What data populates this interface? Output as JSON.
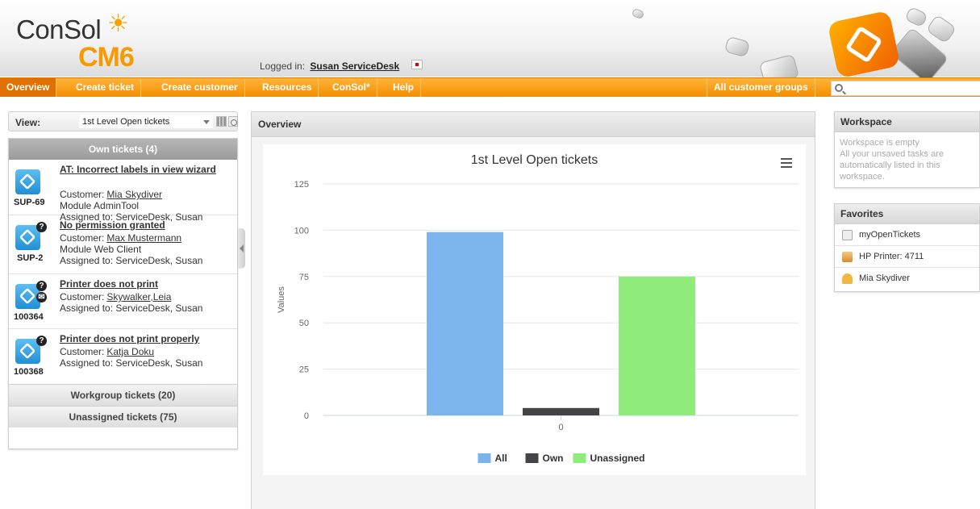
{
  "header": {
    "logo_text": "ConSol",
    "logo_product": "CM6",
    "logged_in_label": "Logged in:",
    "user_name": "Susan ServiceDesk"
  },
  "nav": {
    "items": [
      {
        "label": "Overview",
        "active": true
      },
      {
        "label": "Create ticket"
      },
      {
        "label": "Create customer"
      },
      {
        "label": "Resources"
      },
      {
        "label": "ConSol*"
      },
      {
        "label": "Help"
      }
    ],
    "customer_groups_label": "All customer groups",
    "search_placeholder": ""
  },
  "view": {
    "label": "View:",
    "selected": "1st Level Open tickets"
  },
  "tickets": {
    "own_header": "Own tickets (4)",
    "items": [
      {
        "id": "SUP-69",
        "title": "AT: Incorrect labels in view wizard",
        "customer_label": "Customer:",
        "customer": "Mia Skydiver",
        "module": "Module  AdminTool",
        "assigned": "Assigned to: ServiceDesk, Susan"
      },
      {
        "id": "SUP-2",
        "title": "No permission granted",
        "customer_label": "Customer:",
        "customer": "Max Mustermann",
        "module": "Module  Web Client",
        "assigned": "Assigned to: ServiceDesk, Susan"
      },
      {
        "id": "100364",
        "title": "Printer does not print",
        "customer_label": "Customer:",
        "customer": "Skywalker,Leia",
        "assigned": "Assigned to: ServiceDesk, Susan"
      },
      {
        "id": "100368",
        "title": "Printer does not print properly",
        "customer_label": "Customer:",
        "customer": "Katja Doku",
        "assigned": "Assigned to: ServiceDesk, Susan"
      }
    ],
    "workgroup_label": "Workgroup tickets (20)",
    "unassigned_label": "Unassigned tickets (75)"
  },
  "center": {
    "title": "Overview"
  },
  "chart_data": {
    "type": "bar",
    "title": "1st Level Open tickets",
    "ylabel": "Values",
    "xlabel": "",
    "categories": [
      "0"
    ],
    "ylim": [
      0,
      125
    ],
    "yticks": [
      0,
      25,
      50,
      75,
      100,
      125
    ],
    "grid": true,
    "legend_position": "bottom",
    "series": [
      {
        "name": "All",
        "values": [
          99
        ],
        "color": "#7cb5ec"
      },
      {
        "name": "Own",
        "values": [
          4
        ],
        "color": "#434348"
      },
      {
        "name": "Unassigned",
        "values": [
          75
        ],
        "color": "#90ed7d"
      }
    ]
  },
  "workspace": {
    "title": "Workspace",
    "line1": "Workspace is empty",
    "line2": "All your unsaved tasks are automatically listed in this workspace."
  },
  "favorites": {
    "title": "Favorites",
    "items": [
      {
        "label": "myOpenTickets",
        "icon": "search-icon"
      },
      {
        "label": "HP Printer: 4711",
        "icon": "house-icon"
      },
      {
        "label": "Mia Skydiver",
        "icon": "person-icon"
      }
    ]
  }
}
